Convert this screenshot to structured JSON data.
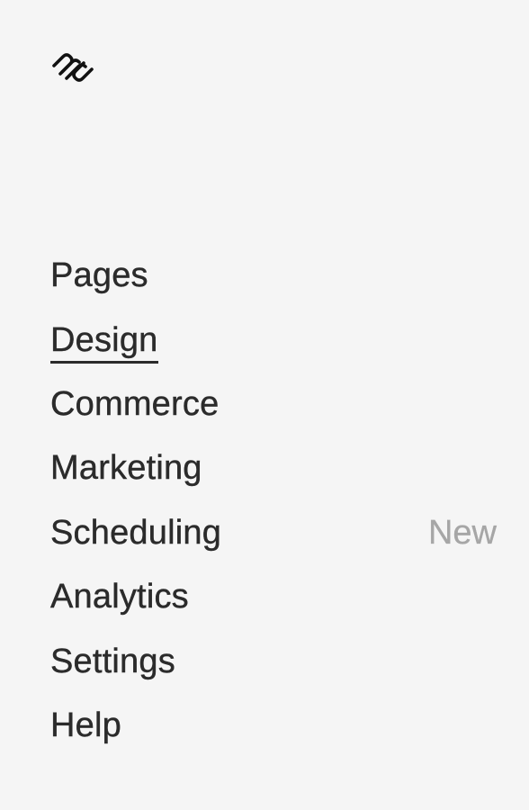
{
  "logo": {
    "icon": "squarespace-logo-icon"
  },
  "nav": {
    "items": [
      {
        "label": "Pages"
      },
      {
        "label": "Design",
        "active": true
      },
      {
        "label": "Commerce"
      },
      {
        "label": "Marketing"
      },
      {
        "label": "Scheduling",
        "badge": "New"
      },
      {
        "label": "Analytics"
      },
      {
        "label": "Settings"
      },
      {
        "label": "Help"
      }
    ]
  },
  "colors": {
    "background": "#f5f5f5",
    "text": "#2b2b2b",
    "badge": "#a6a6a6"
  }
}
